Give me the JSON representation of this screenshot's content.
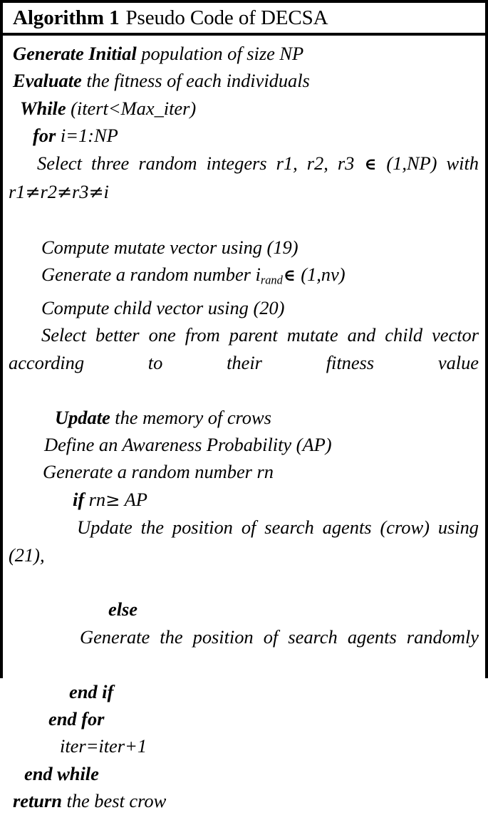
{
  "header": {
    "number_label": "Algorithm 1",
    "title": "Pseudo Code of DECSA"
  },
  "code": {
    "line1_kw": "Generate Initial",
    "line1_rest": " population of size NP",
    "line2_kw": "Evaluate",
    "line2_rest": " the fitness of each individuals",
    "line3_kw": "While",
    "line3_rest": " (itert<Max_iter)",
    "line4_kw": "for",
    "line4_rest": " i=1:NP",
    "line5_a": "Select three random integers r1, r2, r3 ",
    "line5_memberof": "∈",
    "line5_b": " (1,NP) with r1",
    "line5_neq1": "≠",
    "line5_c": "r2",
    "line5_neq2": "≠",
    "line5_d": "r3",
    "line5_neq3": "≠",
    "line5_e": "i",
    "line6": "Compute mutate vector using (19)",
    "line7_a": "Generate a random number i",
    "line7_sub": "rand",
    "line7_memberof": "∈",
    "line7_b": " (1,nv)",
    "line8": "Compute child vector using (20)",
    "line9": "Select better one from parent mutate and child vector according to their fitness value",
    "line10_kw": "Update",
    "line10_rest": " the memory of crows",
    "line11": "Define an Awareness Probability (AP)",
    "line12": "Generate a random number rn",
    "line13_kw": "if",
    "line13_a": " rn",
    "line13_ge": "≥",
    "line13_b": " AP",
    "line14": "Update the position of search agents (crow) using (21),",
    "line15_kw": "else",
    "line16": "Generate the position of search agents randomly",
    "line17_kw": "end if",
    "line18_kw": "end for",
    "line19": "iter=iter+1",
    "line20_kw": "end while",
    "line21_kw": "return",
    "line21_rest": " the best crow"
  },
  "colors": {
    "border": "#000000",
    "text": "#000000",
    "background": "#ffffff"
  }
}
